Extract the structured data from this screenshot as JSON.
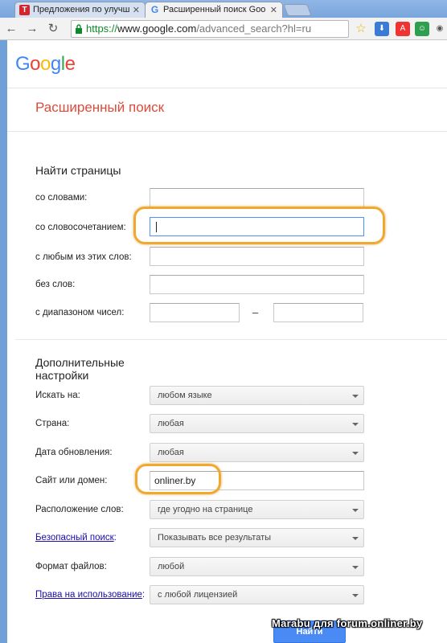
{
  "browser": {
    "tabs": [
      {
        "title": "Предложения по улучш",
        "active": false
      },
      {
        "title": "Расширенный поиск Goo",
        "active": true
      }
    ],
    "url": {
      "scheme": "https://",
      "host": "www.google.com",
      "path": "/advanced_search?hl=ru"
    }
  },
  "logo": {
    "letters": [
      "G",
      "o",
      "o",
      "g",
      "l",
      "e"
    ]
  },
  "page_title": "Расширенный поиск",
  "find_pages": {
    "title": "Найти страницы",
    "fields": {
      "all_words": {
        "label": "со словами:",
        "value": ""
      },
      "exact_phrase": {
        "label": "со словосочетанием:",
        "value": ""
      },
      "any_words": {
        "label": "с любым из этих слов:",
        "value": ""
      },
      "none_words": {
        "label": "без слов:",
        "value": ""
      },
      "number_range": {
        "label": "с диапазоном чисел:",
        "from": "",
        "to": "",
        "dash": "–"
      }
    }
  },
  "advanced": {
    "title_line1": "Дополнительные",
    "title_line2": "настройки",
    "rows": {
      "language": {
        "label": "Искать на:",
        "value": "любом языке"
      },
      "region": {
        "label": "Страна:",
        "value": "любая"
      },
      "last_update": {
        "label": "Дата обновления:",
        "value": "любая"
      },
      "site": {
        "label": "Сайт или домен:",
        "value": "onliner.by"
      },
      "terms_appearing": {
        "label": "Расположение слов:",
        "value": "где угодно на странице"
      },
      "safesearch": {
        "label": "Безопасный поиск",
        "label_suffix": ":",
        "value": "Показывать все результаты"
      },
      "file_type": {
        "label": "Формат файлов:",
        "value": "любой"
      },
      "usage_rights": {
        "label": "Права на использование",
        "label_suffix": ":",
        "value": "с любой лицензией"
      }
    }
  },
  "find_button": "Найти",
  "watermark": "Marabu для forum.onliner.by",
  "colors": {
    "title_red": "#dd4b39",
    "link_blue": "#1a0dab",
    "highlight_orange": "#f0a830",
    "button_blue": "#4a8af4"
  }
}
